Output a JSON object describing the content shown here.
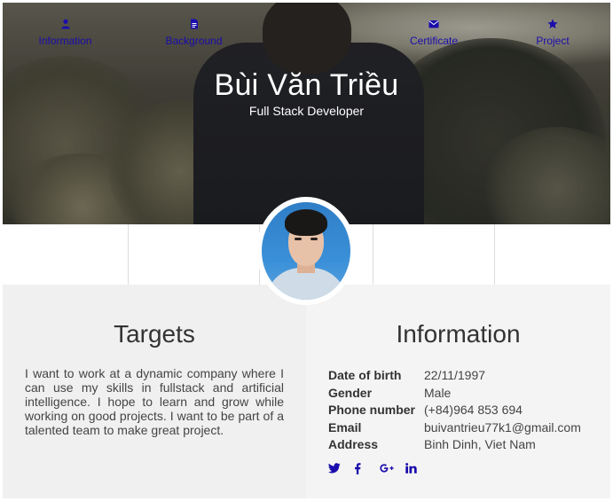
{
  "hero": {
    "name": "Bùi Văn Triều",
    "role": "Full Stack Developer"
  },
  "nav": {
    "items": [
      {
        "label": "Information",
        "icon": "user-icon"
      },
      {
        "label": "Background",
        "icon": "file-icon"
      },
      {
        "label": "Certificate",
        "icon": "envelope-icon"
      },
      {
        "label": "Project",
        "icon": "star-icon"
      }
    ]
  },
  "targets": {
    "title": "Targets",
    "text": "I want to work at a dynamic company where I can use my skills in fullstack and artificial intelligence. I hope to learn and grow while working on good projects. I want to be part of a talented team to make great project."
  },
  "information": {
    "title": "Information",
    "rows": [
      {
        "key": "Date of birth",
        "value": "22/11/1997"
      },
      {
        "key": "Gender",
        "value": "Male"
      },
      {
        "key": "Phone number",
        "value": "(+84)964 853 694"
      },
      {
        "key": "Email",
        "value": "buivantrieu77k1@gmail.com"
      },
      {
        "key": "Address",
        "value": "Binh Dinh, Viet Nam"
      }
    ],
    "social": [
      "twitter-icon",
      "facebook-icon",
      "google-plus-icon",
      "linkedin-icon"
    ]
  },
  "colors": {
    "link": "#1a0dab",
    "nav_bg": "#ffffff",
    "content_bg": "#f2f2f2"
  }
}
